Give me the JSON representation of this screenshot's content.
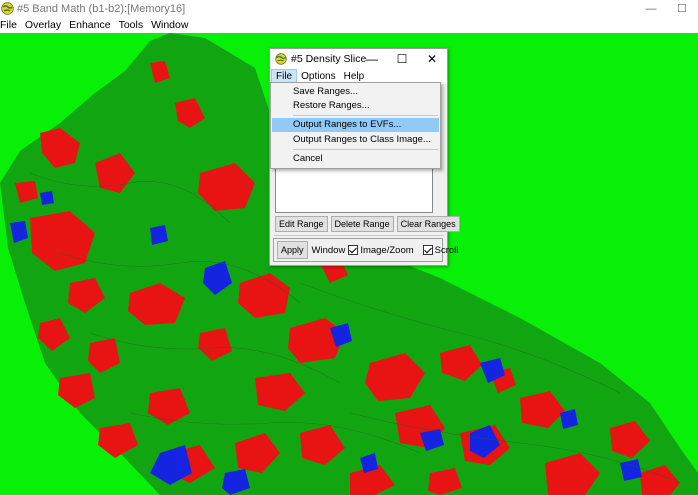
{
  "window": {
    "title": "#5 Band Math (b1-b2):[Memory16]",
    "minimize_glyph": "—",
    "maximize_glyph": "☐"
  },
  "menubar": {
    "items": [
      "File",
      "Overlay",
      "Enhance",
      "Tools",
      "Window"
    ]
  },
  "image": {
    "colors": {
      "background": "#08f008",
      "class_a": "#ee1111",
      "class_b": "#1020e0",
      "nodata": "#ffffff"
    }
  },
  "dialog": {
    "title": "#5 Density Slice",
    "minimize_glyph": "—",
    "maximize_glyph": "☐",
    "close_glyph": "✕",
    "menu": [
      "File",
      "Options",
      "Help"
    ],
    "active_menu": "File",
    "buttons": {
      "edit_range": "Edit Range",
      "delete_range": "Delete Range",
      "clear_ranges": "Clear Ranges",
      "apply": "Apply"
    },
    "window_label": "Window",
    "checkboxes": [
      {
        "label": "Image/Zoom",
        "checked": true
      },
      {
        "label": "Scroll",
        "checked": true
      }
    ]
  },
  "file_menu": {
    "items": [
      {
        "label": "Save Ranges..."
      },
      {
        "label": "Restore Ranges..."
      },
      {
        "label": "Output Ranges to EVFs...",
        "highlighted": true
      },
      {
        "label": "Output Ranges to Class Image..."
      },
      {
        "label": "Cancel"
      }
    ]
  }
}
